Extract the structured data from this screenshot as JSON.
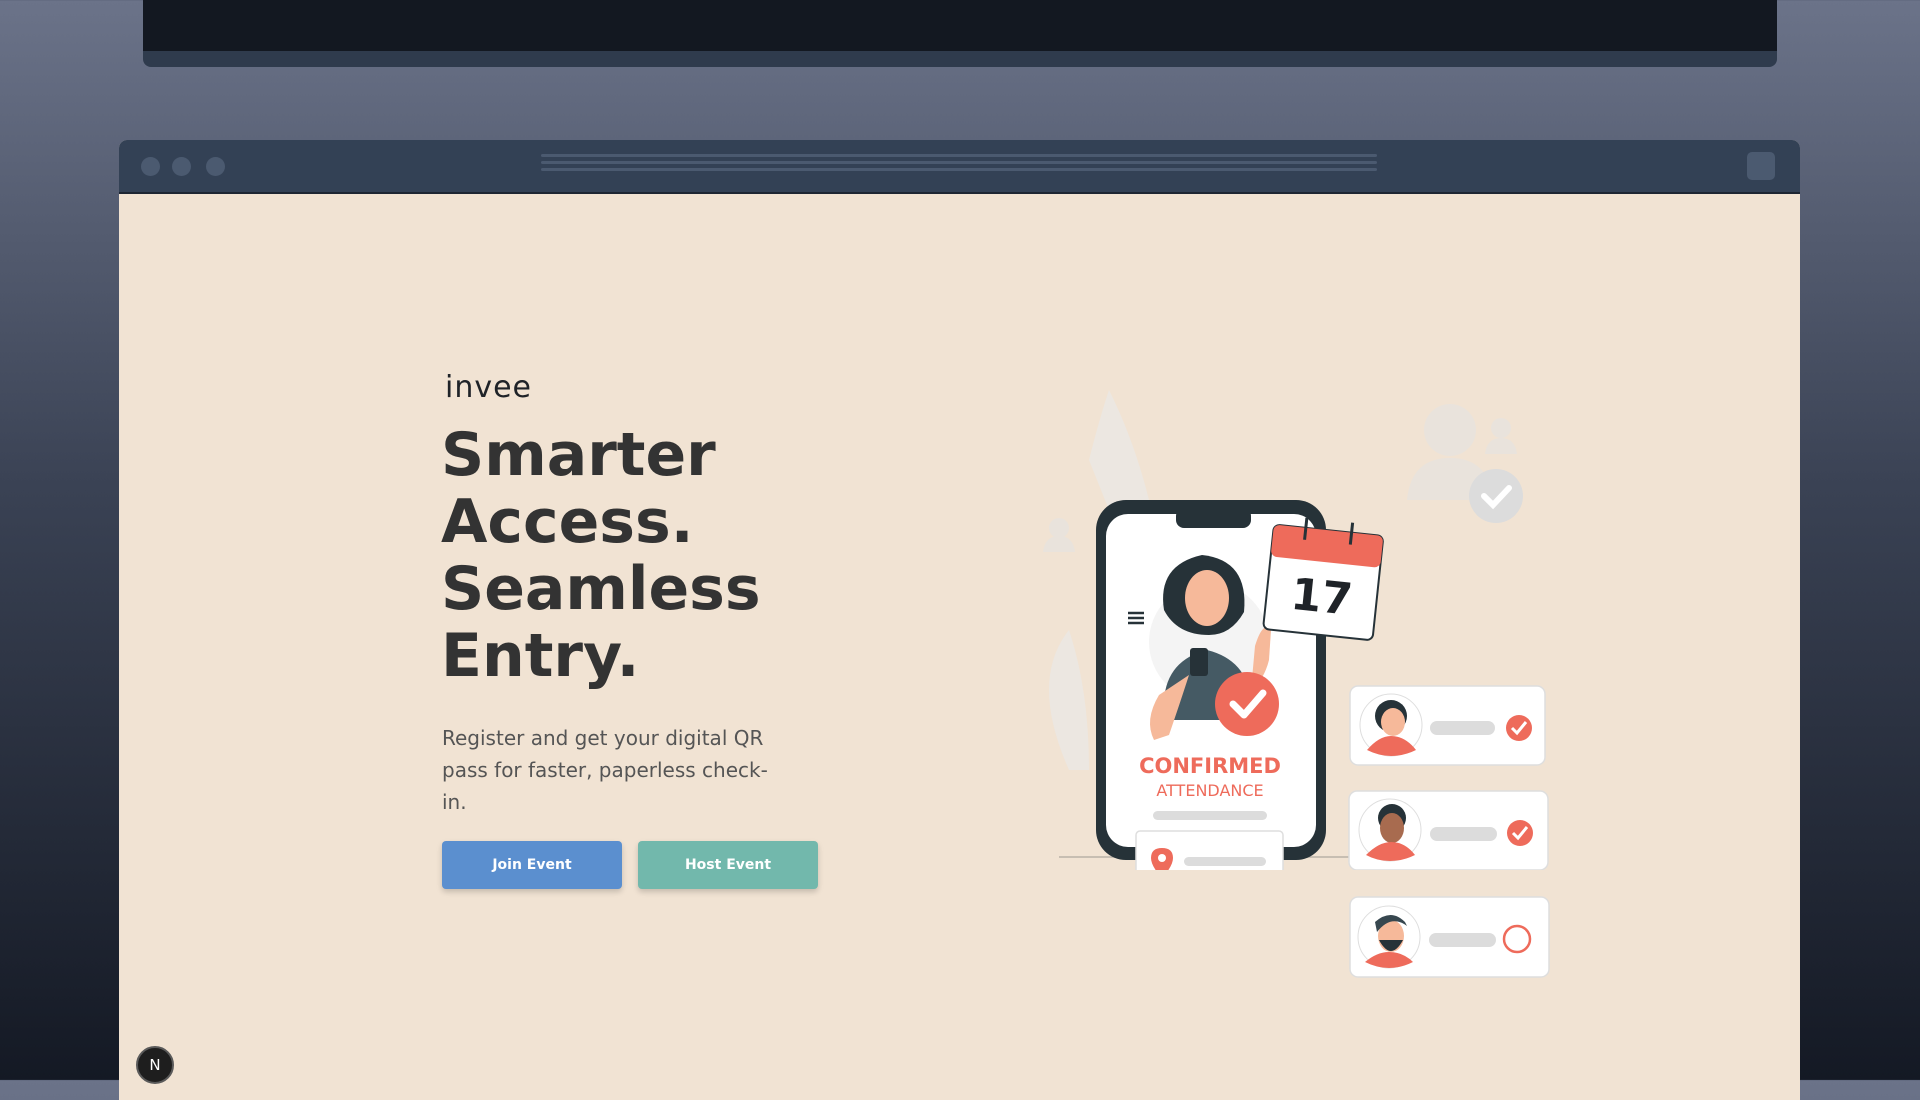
{
  "brand": {
    "name": "invee"
  },
  "hero": {
    "headline_lines": [
      "Smarter",
      "Access.",
      "Seamless",
      "Entry."
    ],
    "subtitle": "Register and get your digital QR pass for faster, paperless check-in.",
    "join_label": "Join Event",
    "host_label": "Host Event"
  },
  "illustration": {
    "calendar_day": "17",
    "status_title": "CONFIRMED",
    "status_subtitle": "ATTENDANCE"
  },
  "badge": {
    "letter": "N"
  },
  "colors": {
    "page_bg": "#f1e3d3",
    "accent_red": "#ee6b5b",
    "join_button": "#5b8fcf",
    "host_button": "#72b8ac",
    "text_dark": "#333333"
  }
}
